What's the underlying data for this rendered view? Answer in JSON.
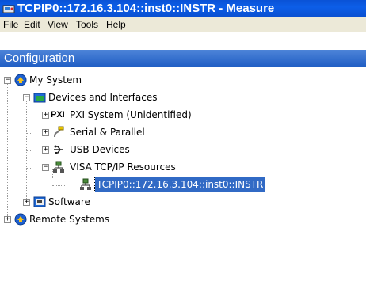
{
  "window": {
    "title": "TCPIP0::172.16.3.104::inst0::INSTR - Measure"
  },
  "menu": [
    {
      "underline": "F",
      "rest": "ile"
    },
    {
      "underline": "E",
      "rest": "dit"
    },
    {
      "underline": "V",
      "rest": "iew"
    },
    {
      "underline": "T",
      "rest": "ools"
    },
    {
      "underline": "H",
      "rest": "elp"
    }
  ],
  "panel": {
    "title": "Configuration"
  },
  "tree": {
    "my_system": "My System",
    "devices_interfaces": "Devices and Interfaces",
    "pxi_system": "PXI System (Unidentified)",
    "pxi_badge": "PXI",
    "serial_parallel": "Serial & Parallel",
    "usb_devices": "USB Devices",
    "visa_tcpip": "VISA TCP/IP Resources",
    "tcpip_instr": "TCPIP0::172.16.3.104::inst0::INSTR",
    "software": "Software",
    "remote_systems": "Remote Systems",
    "expander_plus": "+",
    "expander_minus": "−"
  },
  "colors": {
    "title_bar": "#0a52d6",
    "menu_bg": "#ece9d8",
    "panel_header": "#2a66cc",
    "selection": "#316ac5"
  }
}
